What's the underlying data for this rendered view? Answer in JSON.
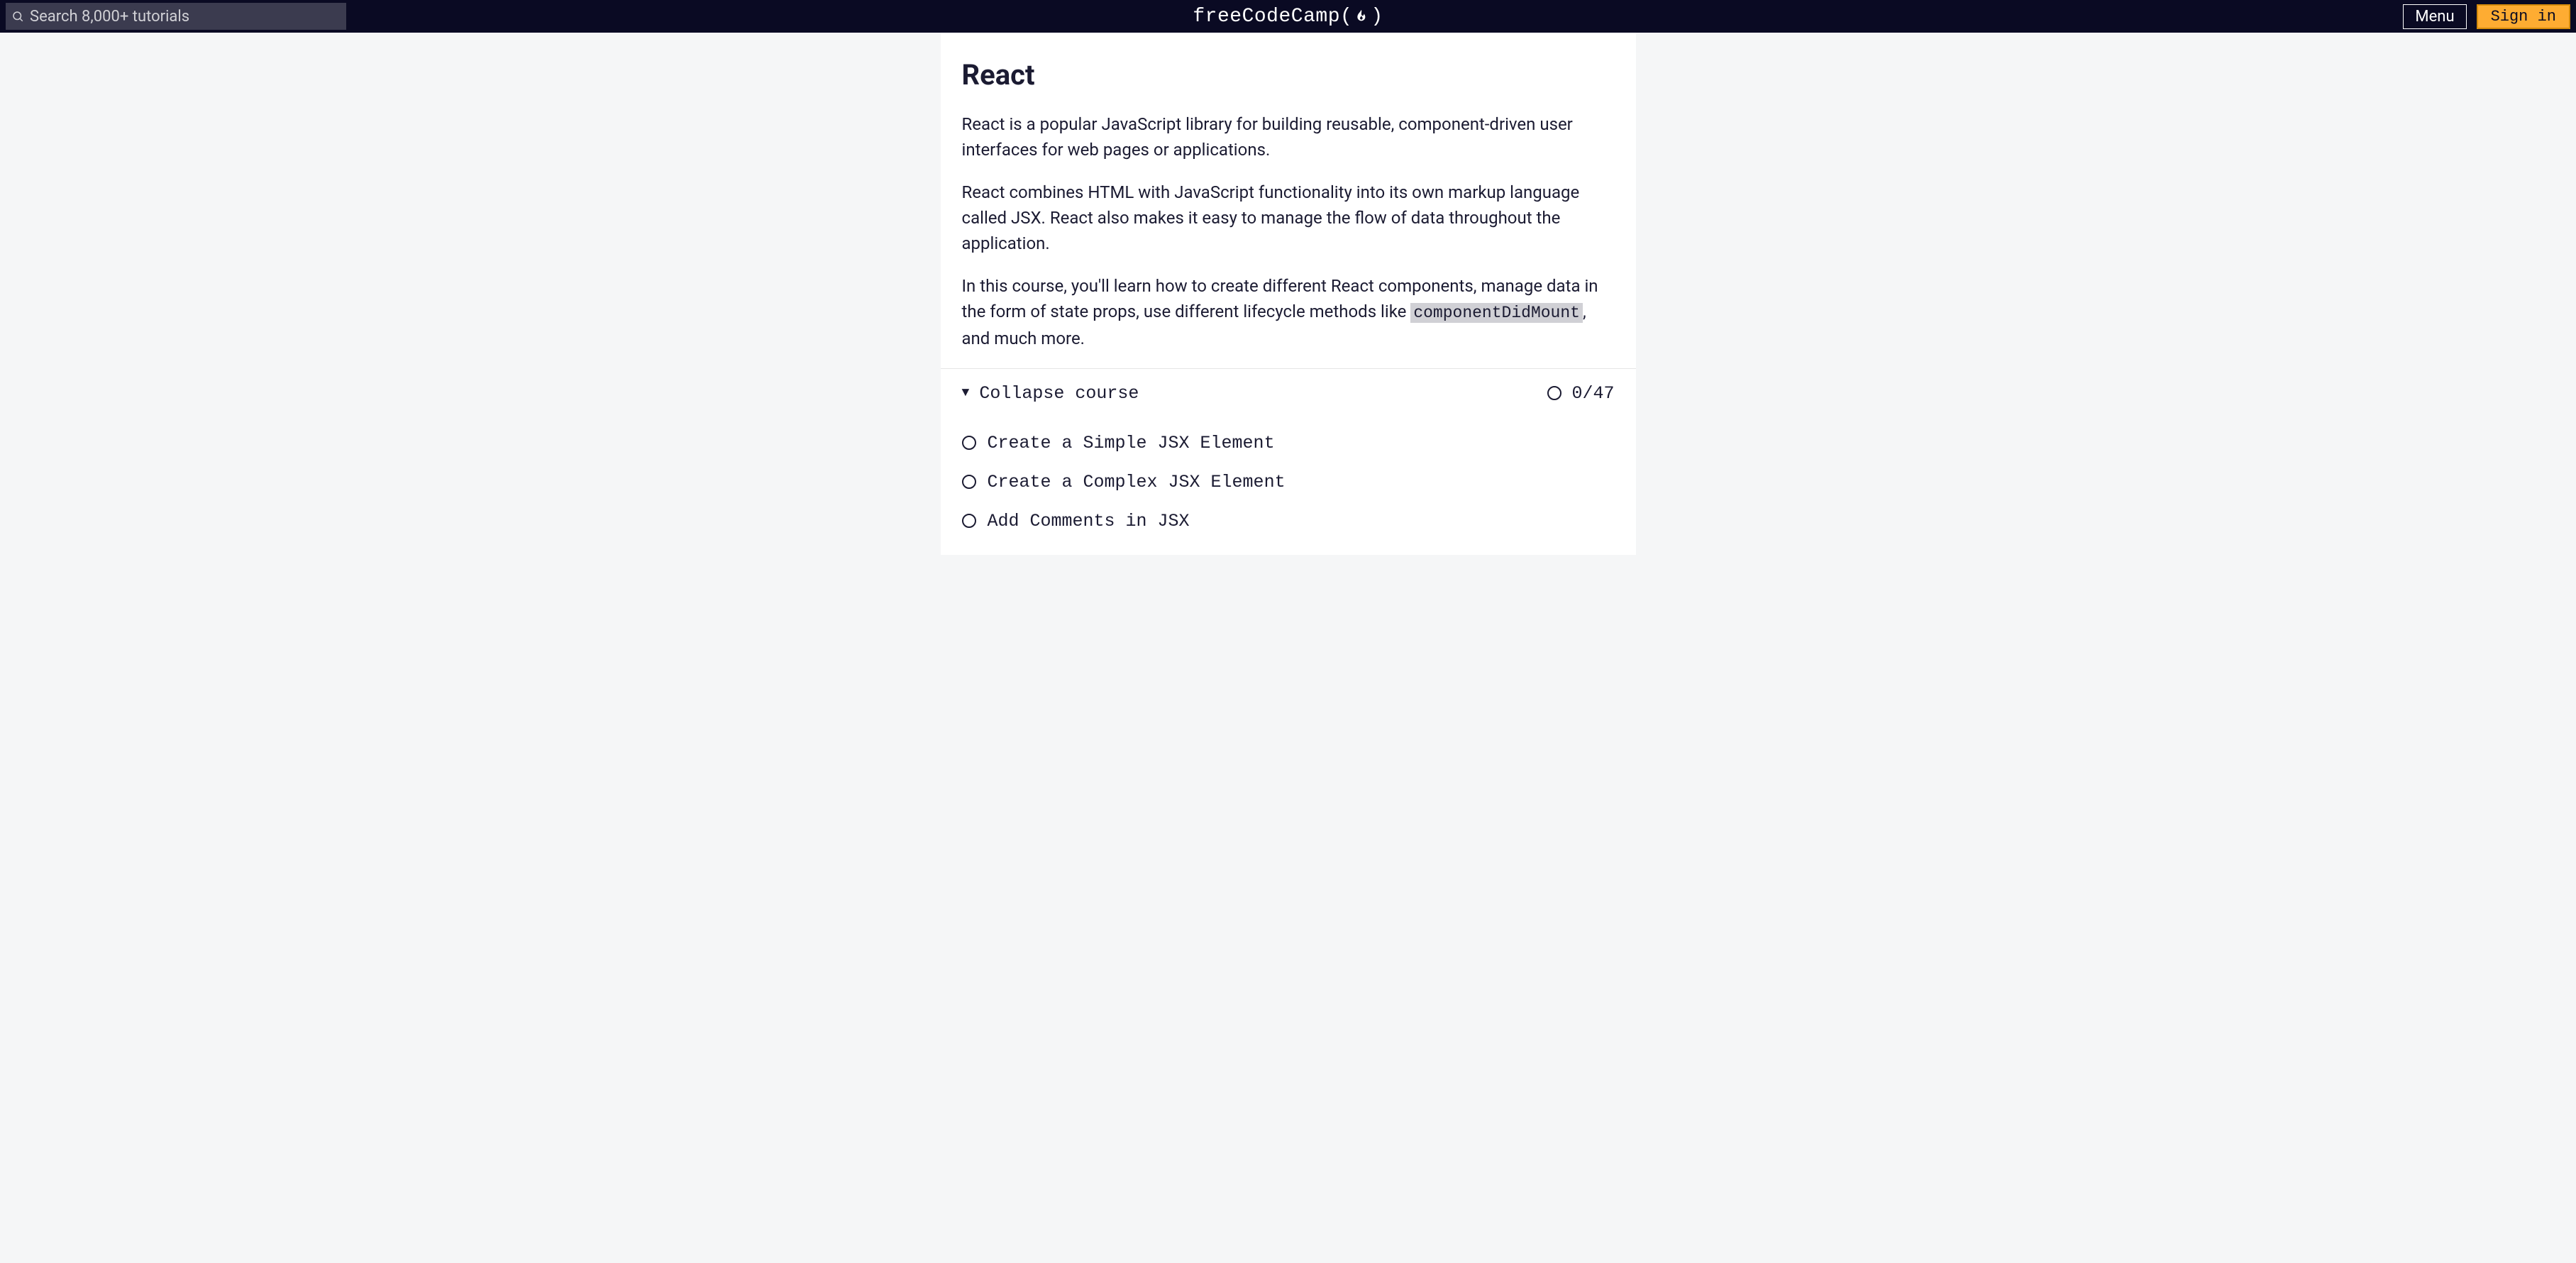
{
  "header": {
    "search_placeholder": "Search 8,000+ tutorials",
    "logo_text": "freeCodeCamp",
    "menu_label": "Menu",
    "signin_label": "Sign in"
  },
  "main": {
    "title": "React",
    "paragraphs": [
      "React is a popular JavaScript library for building reusable, component-driven user interfaces for web pages or applications.",
      "React combines HTML with JavaScript functionality into its own markup language called JSX. React also makes it easy to manage the flow of data throughout the application."
    ],
    "paragraph3_prefix": "In this course, you'll learn how to create different React components, manage data in the form of state props, use different lifecycle methods like ",
    "paragraph3_code": "componentDidMount",
    "paragraph3_suffix": ", and much more."
  },
  "course": {
    "collapse_label": "Collapse course",
    "progress_text": "0/47",
    "lessons": [
      "Create a Simple JSX Element",
      "Create a Complex JSX Element",
      "Add Comments in JSX"
    ]
  }
}
